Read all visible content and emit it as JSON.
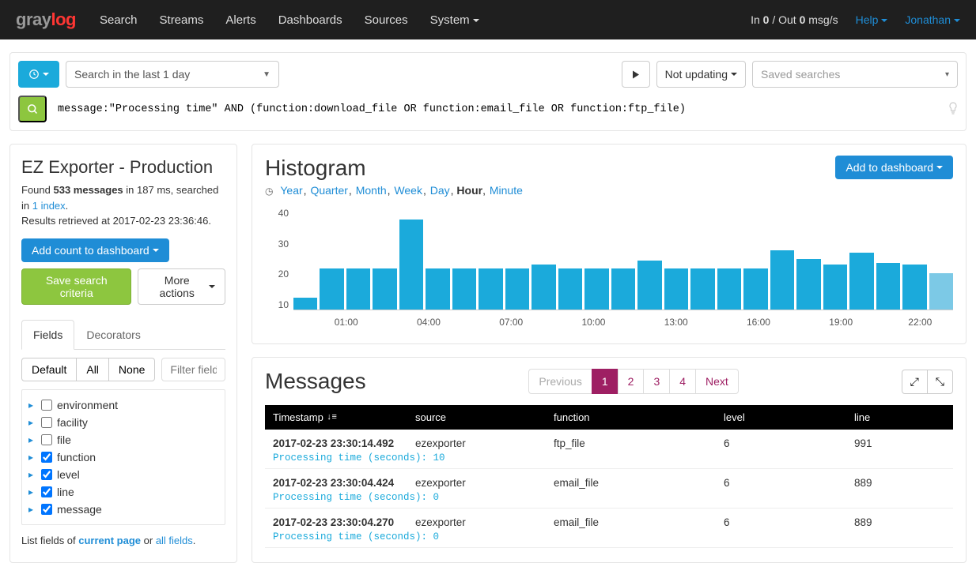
{
  "nav": {
    "links": [
      "Search",
      "Streams",
      "Alerts",
      "Dashboards",
      "Sources",
      "System"
    ],
    "msg_rate": "In 0 / Out 0 msg/s",
    "help": "Help",
    "user": "Jonathan"
  },
  "search": {
    "timerange": "Search in the last 1 day",
    "updating": "Not updating",
    "saved_placeholder": "Saved searches",
    "query": "message:\"Processing time\" AND (function:download_file OR function:email_file OR function:ftp_file)"
  },
  "sidebar": {
    "title": "EZ Exporter - Production",
    "found_count": "533 messages",
    "found_prefix": "Found ",
    "found_suffix": " in 187 ms, searched in ",
    "index_link": "1 index",
    "retrieved": "Results retrieved at 2017-02-23 23:36:46.",
    "add_count": "Add count to dashboard",
    "save_search": "Save search criteria",
    "more_actions": "More actions",
    "tabs": {
      "fields": "Fields",
      "decorators": "Decorators"
    },
    "field_btns": {
      "default": "Default",
      "all": "All",
      "none": "None"
    },
    "filter_placeholder": "Filter fields",
    "fields": [
      {
        "name": "environment",
        "checked": false
      },
      {
        "name": "facility",
        "checked": false
      },
      {
        "name": "file",
        "checked": false
      },
      {
        "name": "function",
        "checked": true
      },
      {
        "name": "level",
        "checked": true
      },
      {
        "name": "line",
        "checked": true
      },
      {
        "name": "message",
        "checked": true
      }
    ],
    "footer_prefix": "List fields of ",
    "footer_cp": "current page",
    "footer_or": " or ",
    "footer_all": "all fields"
  },
  "histogram": {
    "title": "Histogram",
    "add_dash": "Add to dashboard",
    "ranges": [
      "Year",
      "Quarter",
      "Month",
      "Week",
      "Day",
      "Hour",
      "Minute"
    ],
    "selected_range": "Hour"
  },
  "chart_data": {
    "type": "bar",
    "categories": [
      "00:00",
      "01:00",
      "02:00",
      "03:00",
      "04:00",
      "05:00",
      "06:00",
      "07:00",
      "08:00",
      "09:00",
      "10:00",
      "11:00",
      "12:00",
      "13:00",
      "14:00",
      "15:00",
      "16:00",
      "17:00",
      "18:00",
      "19:00",
      "20:00",
      "21:00",
      "22:00",
      "23:00"
    ],
    "values": [
      6,
      20,
      20,
      20,
      44,
      20,
      20,
      20,
      20,
      22,
      20,
      20,
      20,
      24,
      20,
      20,
      20,
      20,
      29,
      25,
      22,
      28,
      23,
      22
    ],
    "ylim": [
      0,
      50
    ],
    "yticks": [
      10,
      20,
      30,
      40
    ],
    "xticks": [
      "01:00",
      "04:00",
      "07:00",
      "10:00",
      "13:00",
      "16:00",
      "19:00",
      "22:00"
    ],
    "xtick_positions_pct": [
      8.0,
      20.5,
      33.0,
      45.5,
      58.0,
      70.5,
      83.0,
      95.0
    ]
  },
  "messages": {
    "title": "Messages",
    "prev": "Previous",
    "next": "Next",
    "pages": [
      "1",
      "2",
      "3",
      "4"
    ],
    "active_page": "1",
    "columns": {
      "ts": "Timestamp",
      "src": "source",
      "fn": "function",
      "lv": "level",
      "ln": "line"
    },
    "rows": [
      {
        "ts": "2017-02-23 23:30:14.492",
        "src": "ezexporter",
        "fn": "ftp_file",
        "lv": "6",
        "ln": "991",
        "detail": "Processing time (seconds): 10"
      },
      {
        "ts": "2017-02-23 23:30:04.424",
        "src": "ezexporter",
        "fn": "email_file",
        "lv": "6",
        "ln": "889",
        "detail": "Processing time (seconds): 0"
      },
      {
        "ts": "2017-02-23 23:30:04.270",
        "src": "ezexporter",
        "fn": "email_file",
        "lv": "6",
        "ln": "889",
        "detail": "Processing time (seconds): 0"
      }
    ]
  }
}
